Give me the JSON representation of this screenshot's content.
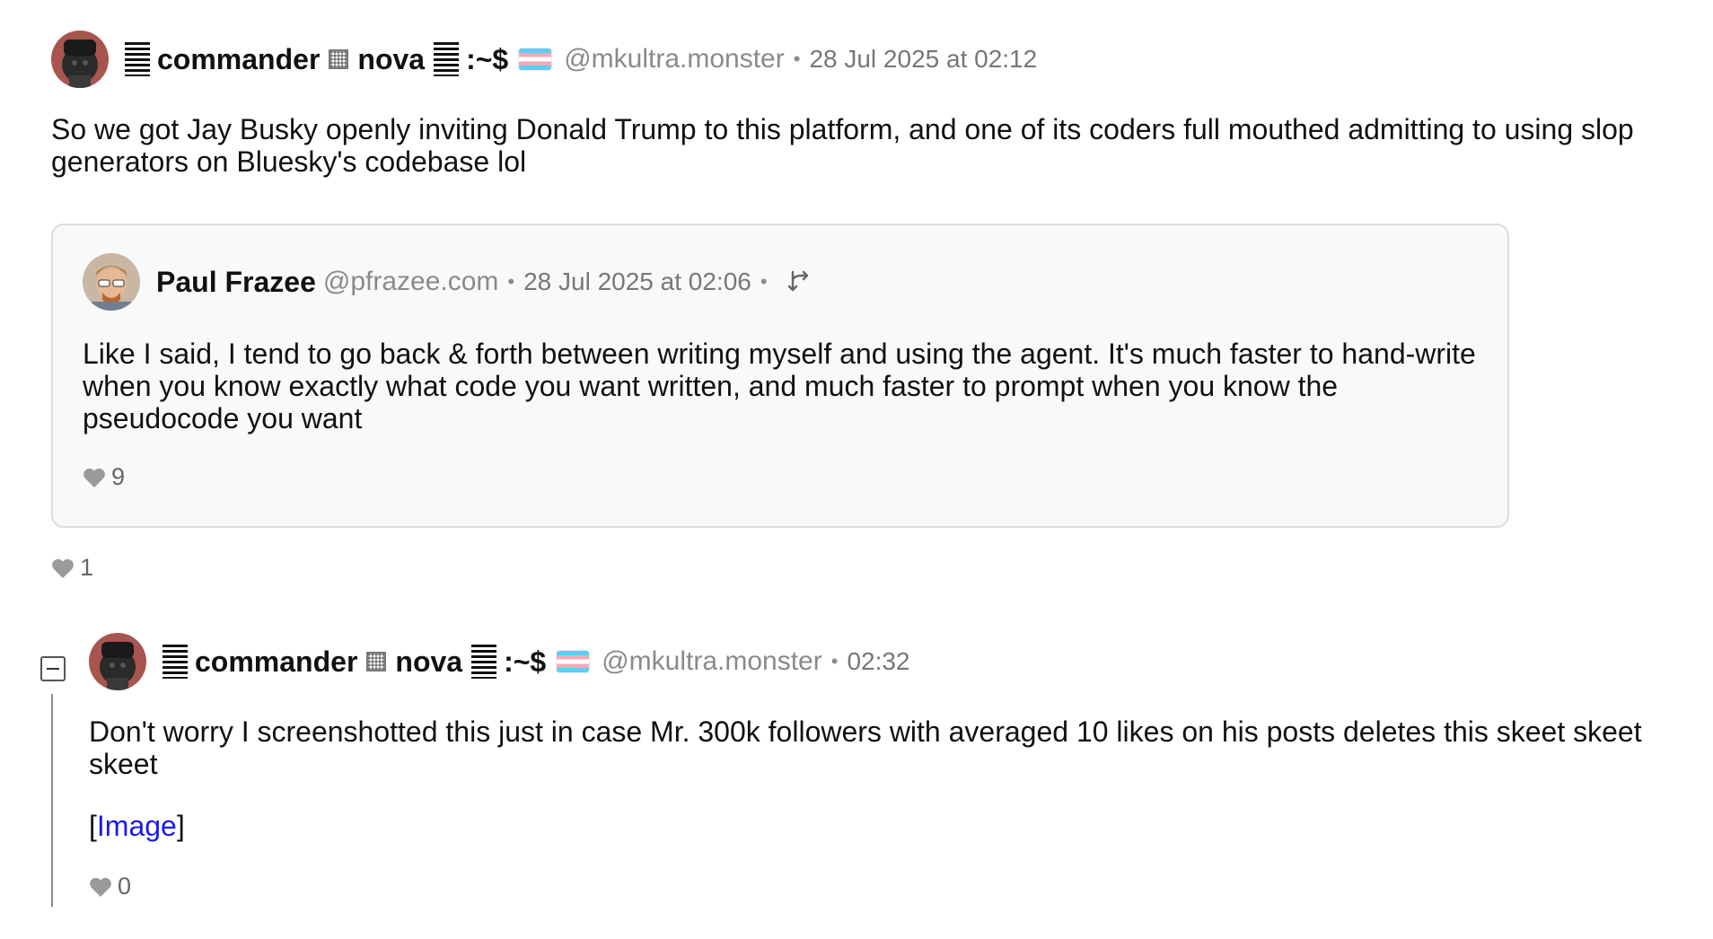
{
  "post": {
    "author": {
      "name_prefix": "commander",
      "name_suffix": "nova",
      "name_tail": ":~$",
      "handle": "@mkultra.monster",
      "flag": "transgender-flag-icon"
    },
    "timestamp": "28 Jul 2025 at 02:12",
    "text": "So we got Jay Busky openly inviting Donald Trump to this platform, and one of its coders full mouthed admitting to using slop generators on Bluesky's codebase lol",
    "likes": "1"
  },
  "quote": {
    "author": {
      "name": "Paul Frazee",
      "handle": "@pfrazee.com"
    },
    "timestamp": "28 Jul 2025 at 02:06",
    "text": "Like I said, I tend to go back & forth between writing myself and using the agent. It's much faster to hand-write when you know exactly what code you want written, and much faster to prompt when you know the pseudocode you want",
    "likes": "9",
    "icon": "reply-branch-icon"
  },
  "reply": {
    "author": {
      "name_prefix": "commander",
      "name_suffix": "nova",
      "name_tail": ":~$",
      "handle": "@mkultra.monster",
      "flag": "transgender-flag-icon"
    },
    "timestamp": "02:32",
    "text": "Don't worry I screenshotted this just in case Mr. 300k followers with averaged 10 likes on his posts deletes this skeet skeet skeet",
    "link_open": "[",
    "link_label": "Image",
    "link_close": "]",
    "likes": "0"
  },
  "colors": {
    "accent_link": "#1a1aef",
    "quote_bg": "#f8f9fb",
    "muted_text": "#777777",
    "heart": "#9a9a9a"
  }
}
